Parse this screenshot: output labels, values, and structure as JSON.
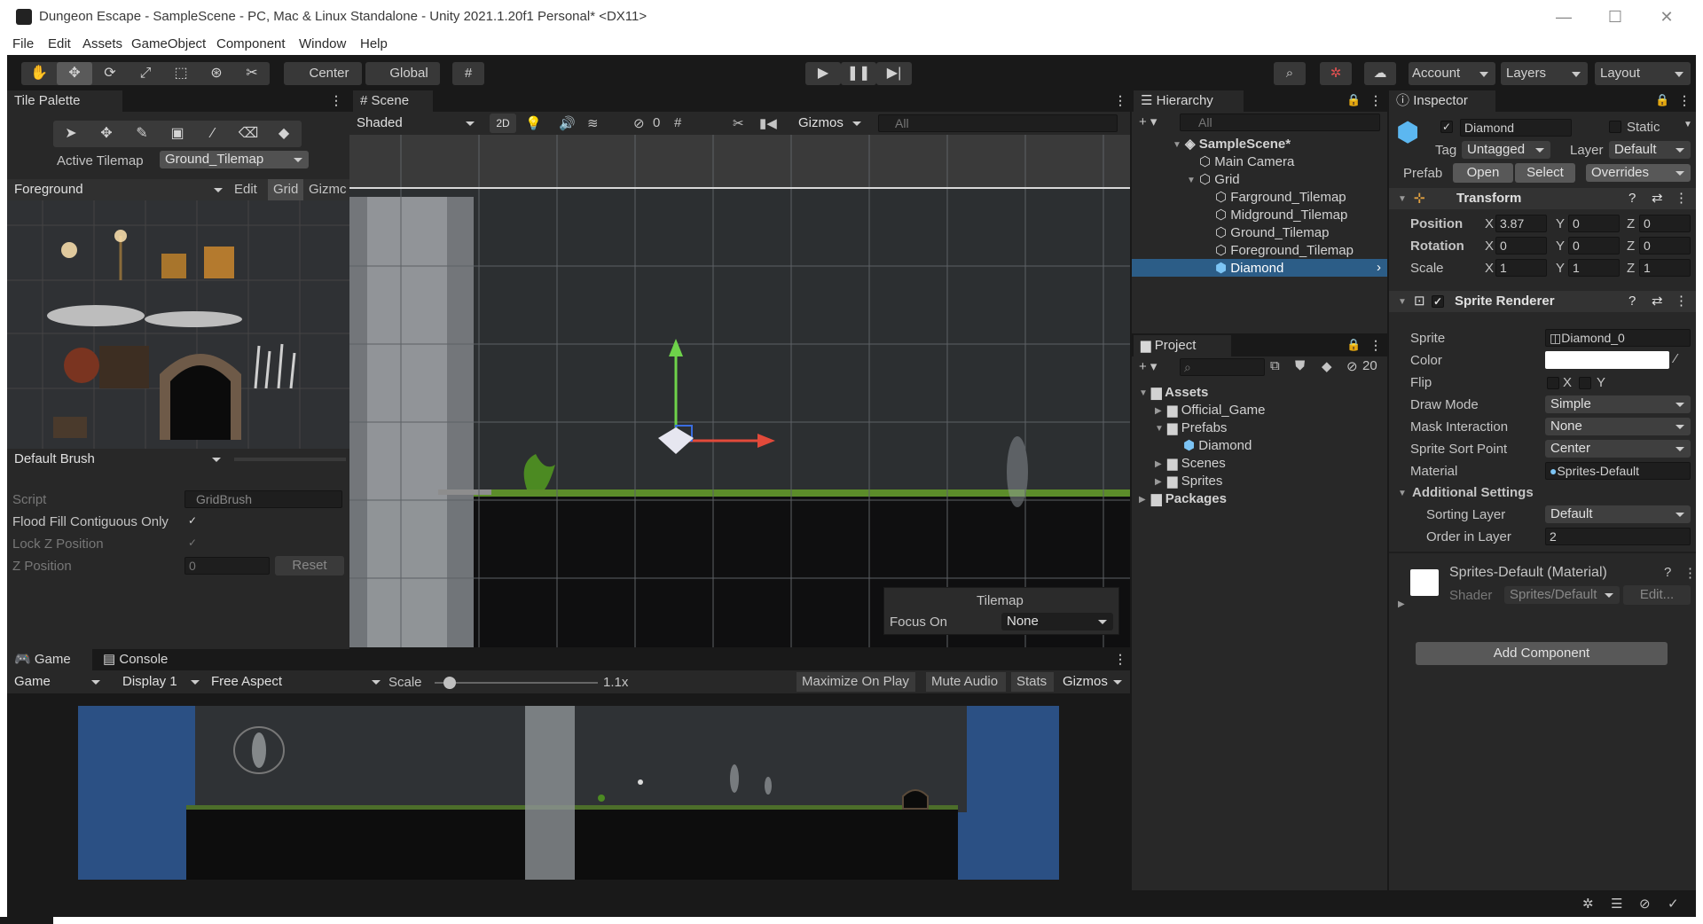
{
  "window": {
    "title": "Dungeon Escape - SampleScene - PC, Mac & Linux Standalone - Unity 2021.1.20f1 Personal* <DX11>",
    "minimize": "—",
    "maximize": "☐",
    "close": "✕"
  },
  "menu": [
    "File",
    "Edit",
    "Assets",
    "GameObject",
    "Component",
    "Window",
    "Help"
  ],
  "toolbar": {
    "pivot": "Center",
    "space": "Global",
    "account": "Account",
    "layers": "Layers",
    "layout": "Layout"
  },
  "tile_palette": {
    "tab": "Tile Palette",
    "active_tilemap_label": "Active Tilemap",
    "active_tilemap": "Ground_Tilemap",
    "palette": "Foreground",
    "edit": "Edit",
    "grid": "Grid",
    "gizmos": "Gizmc",
    "brush": "Default Brush",
    "script_label": "Script",
    "script_value": "GridBrush",
    "flood_label": "Flood Fill Contiguous Only",
    "lockz_label": "Lock Z Position",
    "zpos_label": "Z Position",
    "zpos_value": "0",
    "reset": "Reset"
  },
  "scene": {
    "tab": "Scene",
    "shading": "Shaded",
    "mode2d": "2D",
    "hidden_count": "0",
    "gizmos": "Gizmos",
    "search_placeholder": "All",
    "overlay_title": "Tilemap",
    "focus_label": "Focus On",
    "focus_value": "None"
  },
  "hierarchy": {
    "tab": "Hierarchy",
    "search_placeholder": "All",
    "items": {
      "scene": "SampleScene*",
      "camera": "Main Camera",
      "grid": "Grid",
      "farground": "Farground_Tilemap",
      "midground": "Midground_Tilemap",
      "ground": "Ground_Tilemap",
      "foreground": "Foreground_Tilemap",
      "diamond": "Diamond"
    }
  },
  "project": {
    "tab": "Project",
    "count": "20",
    "items": {
      "assets": "Assets",
      "official": "Official_Game",
      "prefabs": "Prefabs",
      "diamond": "Diamond",
      "scenes": "Scenes",
      "sprites": "Sprites",
      "packages": "Packages"
    }
  },
  "inspector": {
    "tab": "Inspector",
    "name": "Diamond",
    "static": "Static",
    "tag_label": "Tag",
    "tag": "Untagged",
    "layer_label": "Layer",
    "layer": "Default",
    "prefab_label": "Prefab",
    "open": "Open",
    "select": "Select",
    "overrides": "Overrides",
    "transform": {
      "title": "Transform",
      "position_label": "Position",
      "rotation_label": "Rotation",
      "scale_label": "Scale",
      "x": "X",
      "y": "Y",
      "z": "Z",
      "position": [
        "3.87",
        "0",
        "0"
      ],
      "rotation": [
        "0",
        "0",
        "0"
      ],
      "scale": [
        "1",
        "1",
        "1"
      ]
    },
    "sprite_renderer": {
      "title": "Sprite Renderer",
      "sprite_label": "Sprite",
      "sprite": "Diamond_0",
      "color_label": "Color",
      "flip_label": "Flip",
      "flip_x": "X",
      "flip_y": "Y",
      "draw_mode_label": "Draw Mode",
      "draw_mode": "Simple",
      "mask_label": "Mask Interaction",
      "mask": "None",
      "sort_point_label": "Sprite Sort Point",
      "sort_point": "Center",
      "material_label": "Material",
      "material": "Sprites-Default",
      "additional": "Additional Settings",
      "sorting_layer_label": "Sorting Layer",
      "sorting_layer": "Default",
      "order_label": "Order in Layer",
      "order": "2"
    },
    "material": {
      "title": "Sprites-Default (Material)",
      "shader_label": "Shader",
      "shader": "Sprites/Default",
      "edit": "Edit..."
    },
    "add_component": "Add Component"
  },
  "game": {
    "tab_game": "Game",
    "tab_console": "Console",
    "view": "Game",
    "display": "Display 1",
    "aspect": "Free Aspect",
    "scale_label": "Scale",
    "scale_value": "1.1x",
    "scale_level": 0.05,
    "maximize": "Maximize On Play",
    "mute": "Mute Audio",
    "stats": "Stats",
    "gizmos": "Gizmos"
  },
  "colors": {
    "selection": "#2c5d87",
    "panel": "#282828",
    "dark": "#191919",
    "sky": "#3a5a94"
  }
}
